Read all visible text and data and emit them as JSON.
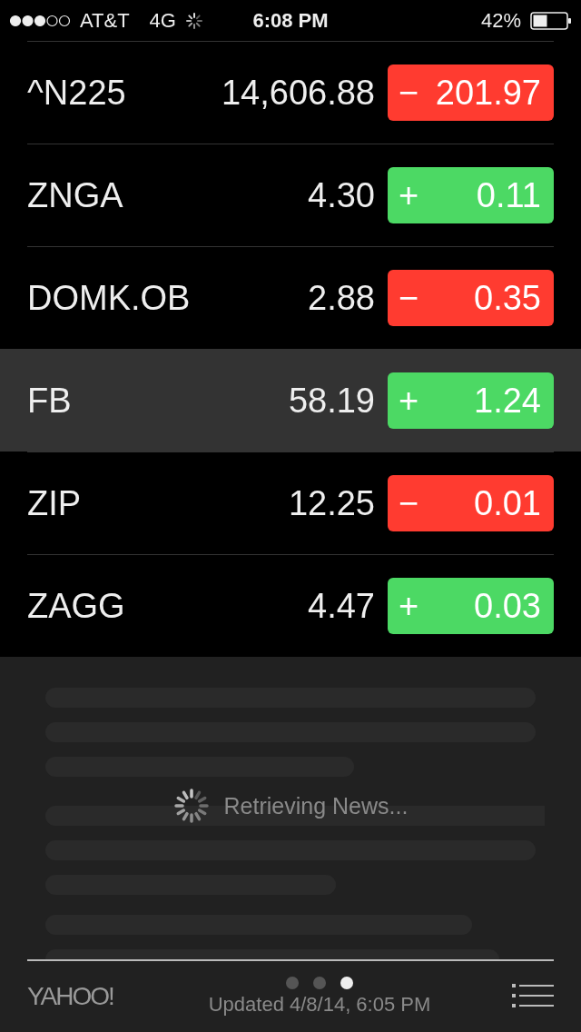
{
  "status_bar": {
    "carrier": "AT&T",
    "network": "4G",
    "time": "6:08 PM",
    "battery": "42%"
  },
  "stocks": [
    {
      "symbol": "^N225",
      "price": "14,606.88",
      "sign": "−",
      "change": "201.97",
      "kind": "down",
      "selected": false
    },
    {
      "symbol": "ZNGA",
      "price": "4.30",
      "sign": "+",
      "change": "0.11",
      "kind": "up",
      "selected": false
    },
    {
      "symbol": "DOMK.OB",
      "price": "2.88",
      "sign": "−",
      "change": "0.35",
      "kind": "down",
      "selected": false
    },
    {
      "symbol": "FB",
      "price": "58.19",
      "sign": "+",
      "change": "1.24",
      "kind": "up",
      "selected": true
    },
    {
      "symbol": "ZIP",
      "price": "12.25",
      "sign": "−",
      "change": "0.01",
      "kind": "down",
      "selected": false
    },
    {
      "symbol": "ZAGG",
      "price": "4.47",
      "sign": "+",
      "change": "0.03",
      "kind": "up",
      "selected": false
    }
  ],
  "news": {
    "loading": "Retrieving News..."
  },
  "footer": {
    "logo": "YAHOO!",
    "pages": [
      {
        "selected": false
      },
      {
        "selected": false
      },
      {
        "selected": true
      }
    ],
    "updated": "Updated 4/8/14, 6:05 PM"
  }
}
